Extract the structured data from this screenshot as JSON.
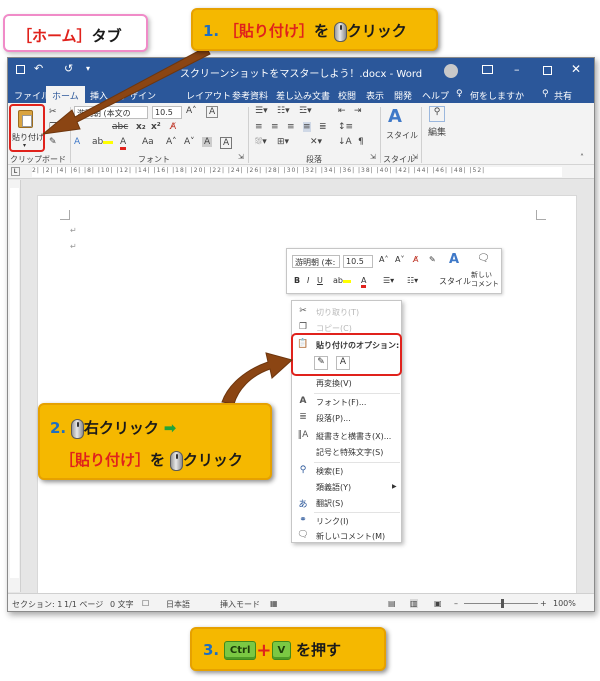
{
  "home_tab_label": {
    "bracket_text": "［ホーム］",
    "suffix": "タブ"
  },
  "steps": {
    "step1": {
      "number": "1.",
      "target": "［貼り付け］",
      "particle": "を",
      "action": "クリック"
    },
    "step2": {
      "number": "2.",
      "action1": "右クリック",
      "arrow": "➡",
      "target": "［貼り付け］",
      "particle": "を",
      "action2": "クリック"
    },
    "step3": {
      "number": "3.",
      "key1": "Ctrl",
      "plus": "+",
      "key2": "V",
      "action": "を押す"
    }
  },
  "window": {
    "title": "スクリーンショットをマスターしよう！.docx - Word",
    "qat": [
      "save-icon",
      "undo-icon",
      "redo-icon"
    ],
    "share": "共有",
    "tell_me": "何をしますか"
  },
  "tabs": [
    {
      "label": "ファイル"
    },
    {
      "label": "ホーム"
    },
    {
      "label": "挿入"
    },
    {
      "label": "デザイン"
    },
    {
      "label": "レイアウト"
    },
    {
      "label": "参考資料"
    },
    {
      "label": "差し込み文書"
    },
    {
      "label": "校閲"
    },
    {
      "label": "表示"
    },
    {
      "label": "開発"
    },
    {
      "label": "ヘルプ"
    }
  ],
  "ribbon": {
    "paste_label": "貼り付け",
    "font_name": "游明朝 (本文の",
    "font_size": "10.5",
    "style_label": "スタイル",
    "edit_label": "編集",
    "groups": {
      "clipboard": "クリップボード",
      "font": "フォント",
      "paragraph": "段落",
      "style": "スタイル"
    }
  },
  "ruler_text": "2|  |2|  |4|  |6|  |8|  |10|  |12|  |14|  |16|  |18|  |20|  |22|  |24|  |26|  |28|  |30|  |32|  |34|  |36|  |38|  |40|  |42|  |44|  |46|  |48|  |52|",
  "mini_toolbar": {
    "font": "游明朝 (本:",
    "size": "10.5",
    "style": "スタイル",
    "new_comment": "新しい\nコメント"
  },
  "context_menu": {
    "items": [
      {
        "label": "切り取り(T)",
        "icon": "cut-icon",
        "enabled": false
      },
      {
        "label": "コピー(C)",
        "icon": "copy-icon",
        "enabled": false
      },
      {
        "label": "貼り付けのオプション:",
        "icon": "paste-icon",
        "enabled": true
      },
      {
        "label": "再変換(V)",
        "icon": "",
        "enabled": true
      },
      {
        "label": "フォント(F)...",
        "icon": "font-icon",
        "enabled": true
      },
      {
        "label": "段落(P)...",
        "icon": "paragraph-icon",
        "enabled": true
      },
      {
        "label": "縦書きと横書き(X)...",
        "icon": "text-direction-icon",
        "enabled": true
      },
      {
        "label": "記号と特殊文字(S)",
        "icon": "",
        "enabled": true
      },
      {
        "label": "検索(E)",
        "icon": "search-icon",
        "enabled": true
      },
      {
        "label": "類義語(Y)",
        "icon": "",
        "enabled": true
      },
      {
        "label": "翻訳(S)",
        "icon": "translate-icon",
        "enabled": true
      },
      {
        "label": "リンク(I)",
        "icon": "link-icon",
        "enabled": true
      },
      {
        "label": "新しいコメント(M)",
        "icon": "comment-icon",
        "enabled": true
      }
    ]
  },
  "status": {
    "section": "セクション: 1",
    "page": "1/1 ページ",
    "words": "0 文字",
    "language": "日本語",
    "mode": "挿入モード",
    "zoom": "100%"
  },
  "colors": {
    "word_blue": "#2b579a",
    "callout": "#f5b800",
    "highlight_red": "#e0221c",
    "key_green": "#7bc843",
    "arrow": "#8b4513"
  }
}
